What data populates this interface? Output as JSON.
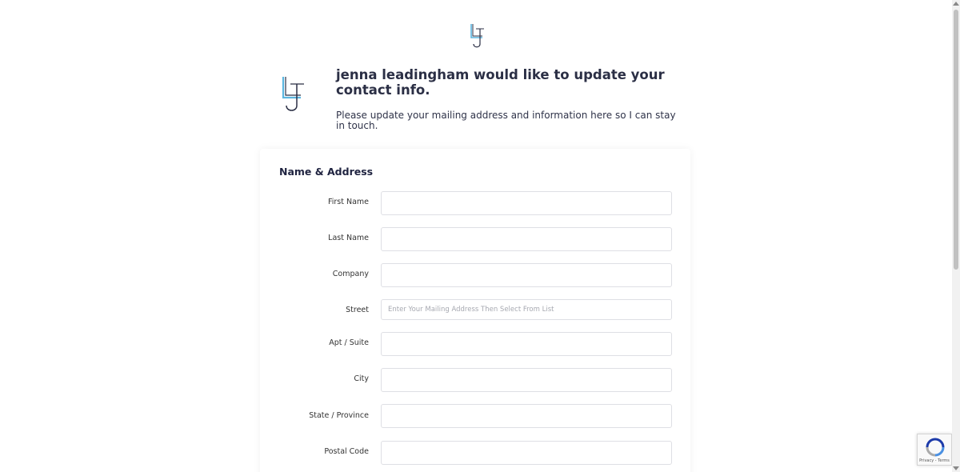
{
  "header": {
    "logo_icon": "lj-monogram-icon"
  },
  "intro": {
    "headline": "jenna leadingham would like to update your contact info.",
    "message": "Please update your mailing address and information here so I can stay in touch."
  },
  "form": {
    "section_title": "Name & Address",
    "fields": [
      {
        "label": "First Name",
        "value": "",
        "placeholder": ""
      },
      {
        "label": "Last Name",
        "value": "",
        "placeholder": ""
      },
      {
        "label": "Company",
        "value": "",
        "placeholder": ""
      },
      {
        "label": "Street",
        "value": "",
        "placeholder": "Enter Your Mailing Address Then Select From List"
      },
      {
        "label": "Apt / Suite",
        "value": "",
        "placeholder": ""
      },
      {
        "label": "City",
        "value": "",
        "placeholder": ""
      },
      {
        "label": "State / Province",
        "value": "",
        "placeholder": ""
      },
      {
        "label": "Postal Code",
        "value": "",
        "placeholder": ""
      }
    ]
  },
  "recaptcha": {
    "footer": "Privacy - Terms",
    "icon": "recaptcha-icon"
  },
  "colors": {
    "text_dark": "#1f2340",
    "logo_blue": "#5bb6e0",
    "logo_dark": "#2b2f45",
    "field_border": "#dedfe4"
  }
}
